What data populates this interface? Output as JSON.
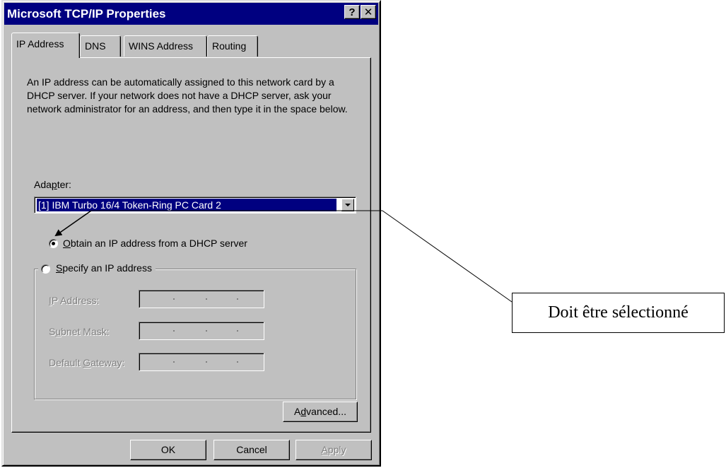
{
  "window": {
    "title": "Microsoft TCP/IP Properties",
    "help_button": "?",
    "close_button": "✕"
  },
  "tabs": [
    {
      "label": "IP Address",
      "active": true
    },
    {
      "label": "DNS",
      "active": false
    },
    {
      "label": "WINS Address",
      "active": false
    },
    {
      "label": "Routing",
      "active": false
    }
  ],
  "description": "An IP address can be automatically assigned to this network card by a DHCP server.  If your network does not have a DHCP server, ask your network administrator for an address, and then type it in the space below.",
  "adapter": {
    "label_pre": "Ada",
    "label_accel": "p",
    "label_post": "ter:",
    "selected": "[1] IBM Turbo 16/4 Token-Ring PC Card 2"
  },
  "dhcp_option": {
    "accel": "O",
    "rest": "btain an IP address from a DHCP server",
    "checked": true
  },
  "specify_option": {
    "accel": "S",
    "rest": "pecify an IP address",
    "checked": false
  },
  "fields": [
    {
      "label_accel": "I",
      "label_rest": "P Address:",
      "value": ""
    },
    {
      "label_pre": "S",
      "label_accel": "u",
      "label_rest": "bnet Mask:",
      "value": ""
    },
    {
      "label_pre": "Default ",
      "label_accel": "G",
      "label_rest": "ateway:",
      "value": ""
    }
  ],
  "buttons": {
    "advanced_pre": "A",
    "advanced_accel": "d",
    "advanced_post": "vanced...",
    "ok": "OK",
    "cancel": "Cancel",
    "apply_accel": "A",
    "apply_rest": "pply"
  },
  "annotation": {
    "text": "Doit être sélectionné"
  }
}
